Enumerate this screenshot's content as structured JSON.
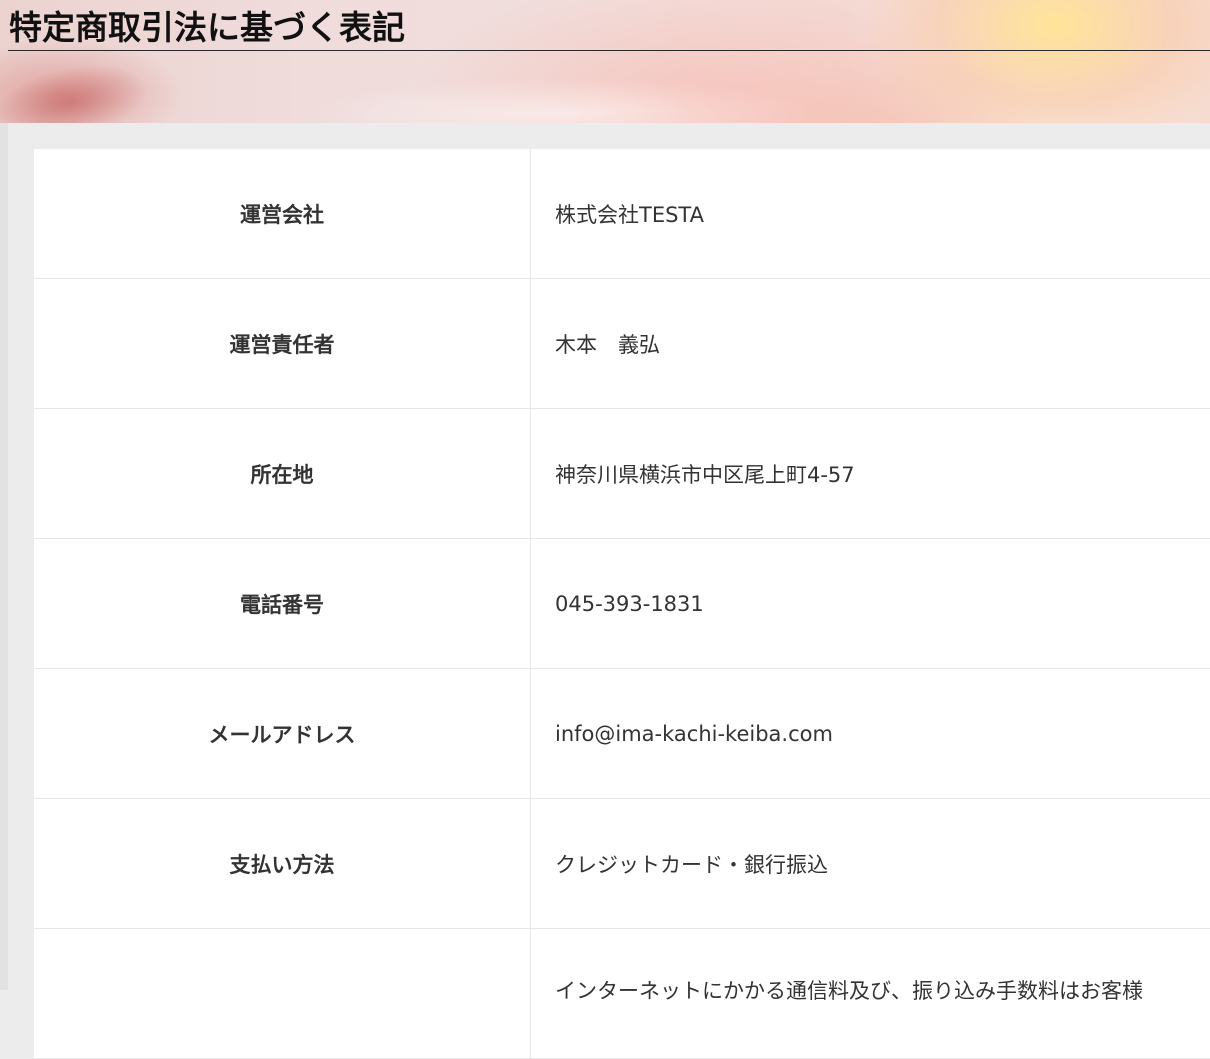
{
  "page": {
    "title": "特定商取引法に基づく表記"
  },
  "table": {
    "rows": [
      {
        "label": "運営会社",
        "value": "株式会社TESTA"
      },
      {
        "label": "運営責任者",
        "value": "木本　義弘"
      },
      {
        "label": "所在地",
        "value": "神奈川県横浜市中区尾上町4-57"
      },
      {
        "label": "電話番号",
        "value": "045-393-1831"
      },
      {
        "label": "メールアドレス",
        "value": "info@ima-kachi-keiba.com"
      },
      {
        "label": "支払い方法",
        "value": "クレジットカード・銀行振込"
      },
      {
        "label": "",
        "value": "インターネットにかかる通信料及び、振り込み手数料はお客様"
      }
    ]
  }
}
